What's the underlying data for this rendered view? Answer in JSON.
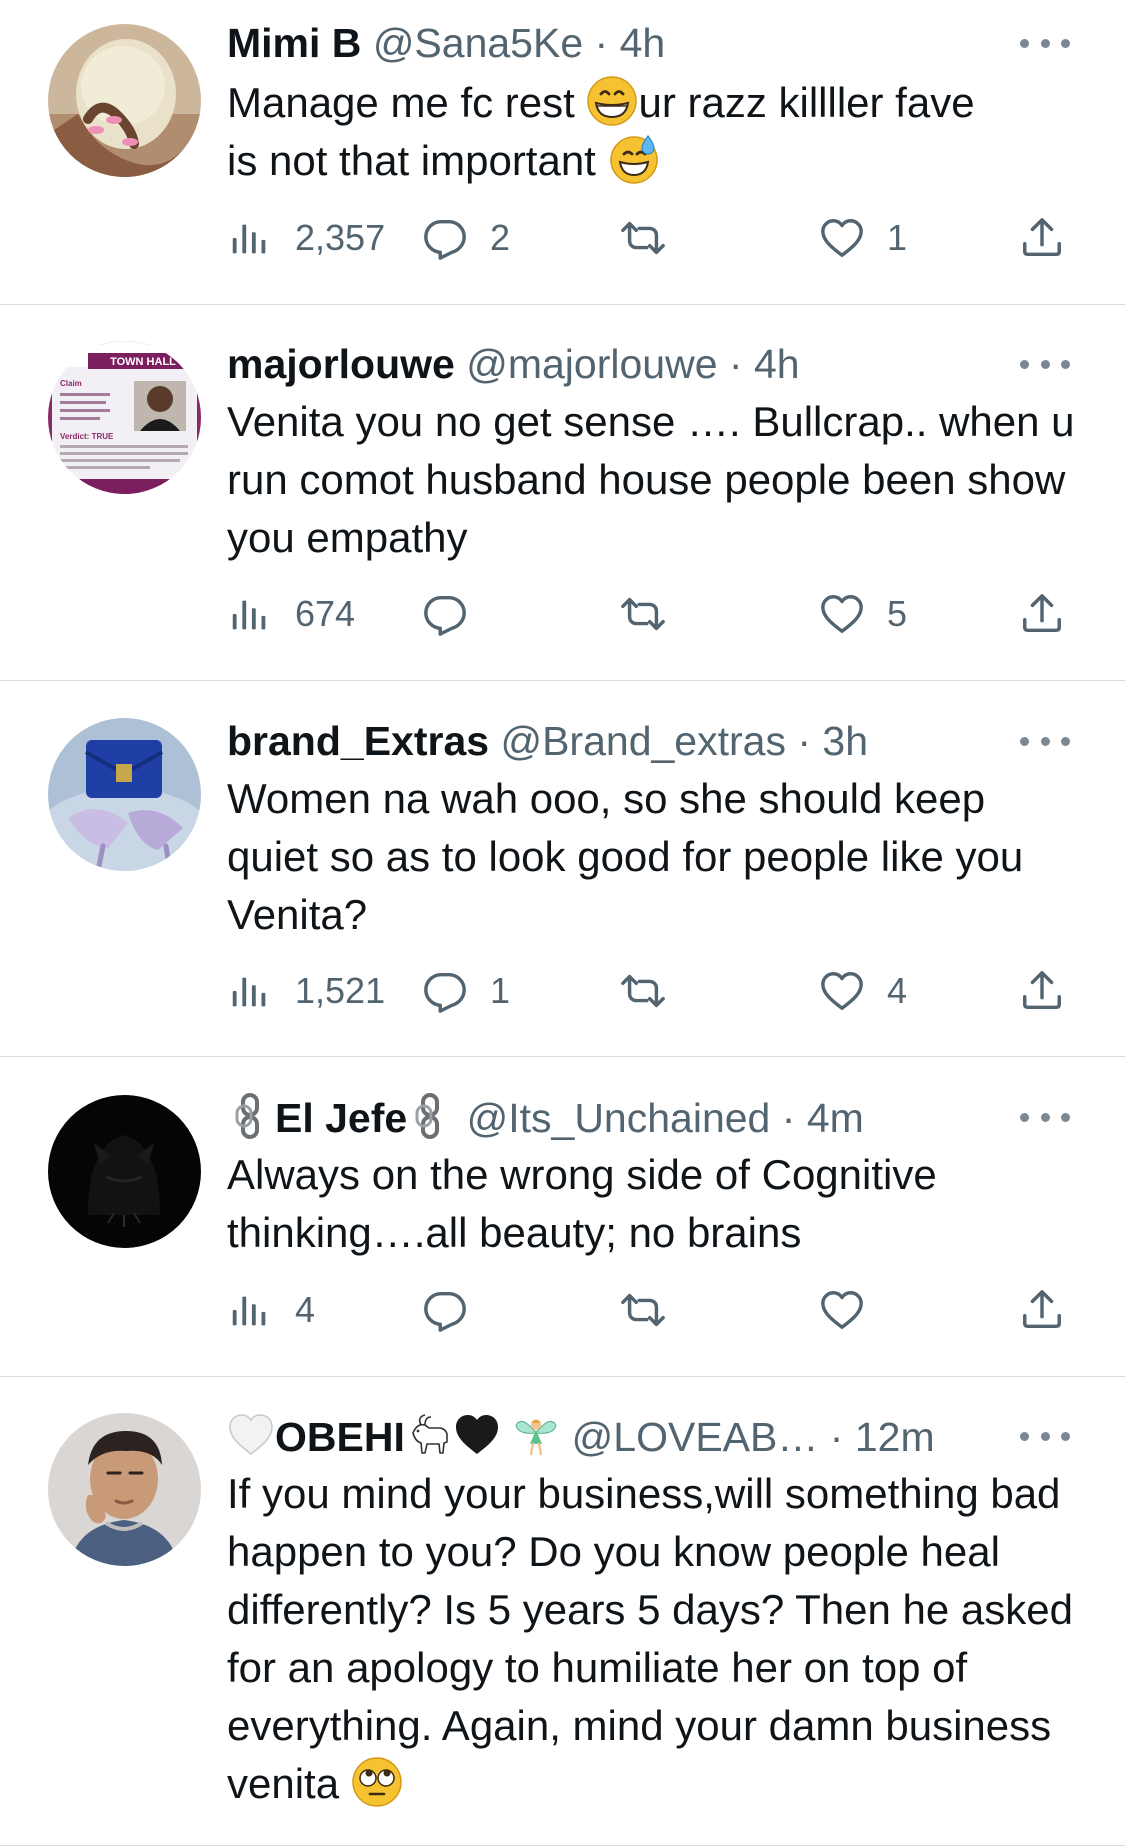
{
  "icons": {
    "views": "bar-chart-icon",
    "reply": "reply-bubble-icon",
    "retweet": "retweet-icon",
    "like": "heart-icon",
    "share": "share-upload-icon",
    "more": "more-dots-icon"
  },
  "colors": {
    "text": "#0f1419",
    "secondary": "#536471",
    "divider": "#d6dbe0"
  },
  "tweets": [
    {
      "name": "Mimi B",
      "handle": "@Sana5Ke",
      "dot": "·",
      "time": "4h",
      "line1a": "Manage me fc rest ",
      "line1b": "ur razz killller fave",
      "line2": "is not that important ",
      "views": "2,357",
      "replies": "2",
      "retweets": "",
      "likes": "1"
    },
    {
      "name": "majorlouwe",
      "handle": "@majorlouwe",
      "dot": "·",
      "time": "4h",
      "text": "Venita you no get sense …. Bullcrap.. when u run comot husband house people been show you empathy",
      "views": "674",
      "replies": "",
      "retweets": "",
      "likes": "5",
      "avatar_text": {
        "banner": "TOWN HALL",
        "claim": "Claim",
        "verdict": "Verdict: TRUE"
      }
    },
    {
      "name": "brand_Extras",
      "handle": "@Brand_extras",
      "dot": "·",
      "time": "3h",
      "text": "Women na wah ooo, so she should  keep quiet so as to look good for people like you Venita?",
      "views": "1,521",
      "replies": "1",
      "retweets": "",
      "likes": "4"
    },
    {
      "name": "El Jefe",
      "handle": "@Its_Unchained",
      "dot": "·",
      "time": "4m",
      "text": "Always on the wrong side of Cognitive thinking….all beauty; no brains",
      "views": "4",
      "replies": "",
      "retweets": "",
      "likes": ""
    },
    {
      "name": "OBEHI",
      "handle": "@LOVEAB…",
      "dot": "·",
      "time": "12m",
      "text": "If you mind your business,will something bad happen to you? Do you know people heal differently? Is 5 years 5 days? Then he asked for an apology to humiliate her on top of everything. Again, mind your damn  business venita "
    }
  ]
}
